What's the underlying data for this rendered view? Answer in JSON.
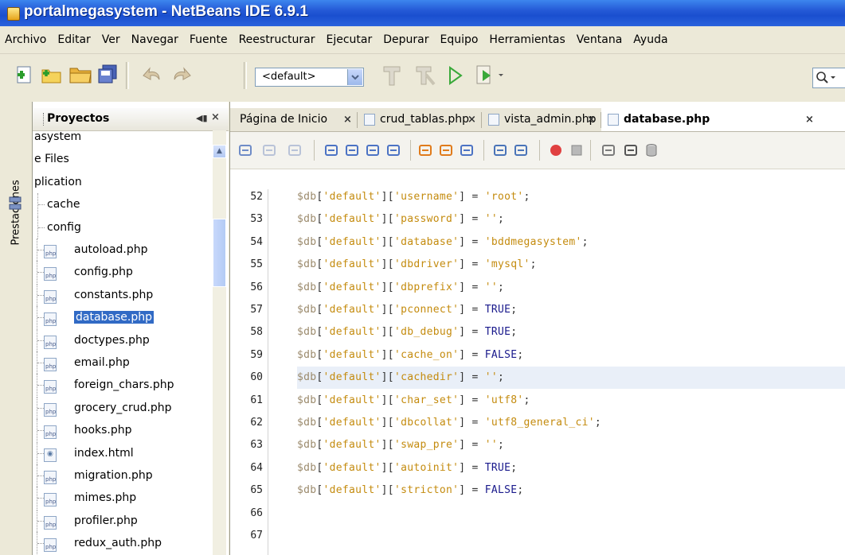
{
  "window": {
    "title": "portalmegasystem - NetBeans IDE 6.9.1"
  },
  "menu": [
    "Archivo",
    "Editar",
    "Ver",
    "Navegar",
    "Fuente",
    "Reestructurar",
    "Ejecutar",
    "Depurar",
    "Equipo",
    "Herramientas",
    "Ventana",
    "Ayuda"
  ],
  "toolbar": {
    "configuration": "<default>",
    "buttons": [
      "new-file-icon",
      "new-project-icon",
      "open-project-icon",
      "save-all-icon",
      "undo-icon",
      "redo-icon",
      "build-hammer-icon",
      "clean-build-icon",
      "run-icon",
      "debug-icon"
    ]
  },
  "side": {
    "tab_label": "Prestaciones"
  },
  "projects": {
    "title": "Proyectos",
    "tree": [
      {
        "label": "asystem",
        "type": "project"
      },
      {
        "label": "e Files",
        "type": "folder"
      },
      {
        "label": "plication",
        "type": "folder"
      },
      {
        "label": "cache",
        "type": "folder"
      },
      {
        "label": "config",
        "type": "folder"
      },
      {
        "label": "autoload.php",
        "type": "php"
      },
      {
        "label": "config.php",
        "type": "php"
      },
      {
        "label": "constants.php",
        "type": "php"
      },
      {
        "label": "database.php",
        "type": "php",
        "selected": true
      },
      {
        "label": "doctypes.php",
        "type": "php"
      },
      {
        "label": "email.php",
        "type": "php"
      },
      {
        "label": "foreign_chars.php",
        "type": "php"
      },
      {
        "label": "grocery_crud.php",
        "type": "php"
      },
      {
        "label": "hooks.php",
        "type": "php"
      },
      {
        "label": "index.html",
        "type": "html"
      },
      {
        "label": "migration.php",
        "type": "php"
      },
      {
        "label": "mimes.php",
        "type": "php"
      },
      {
        "label": "profiler.php",
        "type": "php"
      },
      {
        "label": "redux_auth.php",
        "type": "php"
      }
    ]
  },
  "editor": {
    "tabs": [
      {
        "label": "Página de Inicio",
        "active": false,
        "icon": false
      },
      {
        "label": "crud_tablas.php",
        "active": false,
        "icon": true
      },
      {
        "label": "vista_admin.php",
        "active": false,
        "icon": true
      },
      {
        "label": "database.php",
        "active": true,
        "icon": true
      }
    ],
    "close_glyph": "×",
    "highlighted_line": 60,
    "lines": [
      {
        "n": "52",
        "key": "username",
        "value": "'root'"
      },
      {
        "n": "53",
        "key": "password",
        "value": "''"
      },
      {
        "n": "54",
        "key": "database",
        "value": "'bddmegasystem'"
      },
      {
        "n": "55",
        "key": "dbdriver",
        "value": "'mysql'"
      },
      {
        "n": "56",
        "key": "dbprefix",
        "value": "''"
      },
      {
        "n": "57",
        "key": "pconnect",
        "value": "TRUE"
      },
      {
        "n": "58",
        "key": "db_debug",
        "value": "TRUE"
      },
      {
        "n": "59",
        "key": "cache_on",
        "value": "FALSE"
      },
      {
        "n": "60",
        "key": "cachedir",
        "value": "''"
      },
      {
        "n": "61",
        "key": "char_set",
        "value": "'utf8'"
      },
      {
        "n": "62",
        "key": "dbcollat",
        "value": "'utf8_general_ci'"
      },
      {
        "n": "63",
        "key": "swap_pre",
        "value": "''"
      },
      {
        "n": "64",
        "key": "autoinit",
        "value": "TRUE"
      },
      {
        "n": "65",
        "key": "stricton",
        "value": "FALSE"
      },
      {
        "n": "66",
        "key": null,
        "value": null
      },
      {
        "n": "67",
        "key": null,
        "value": null
      }
    ]
  },
  "colors": {
    "titlebar": "#2459d6",
    "selection": "#316ac5",
    "string": "#c48b0e",
    "keyword": "#1a1a8c"
  }
}
